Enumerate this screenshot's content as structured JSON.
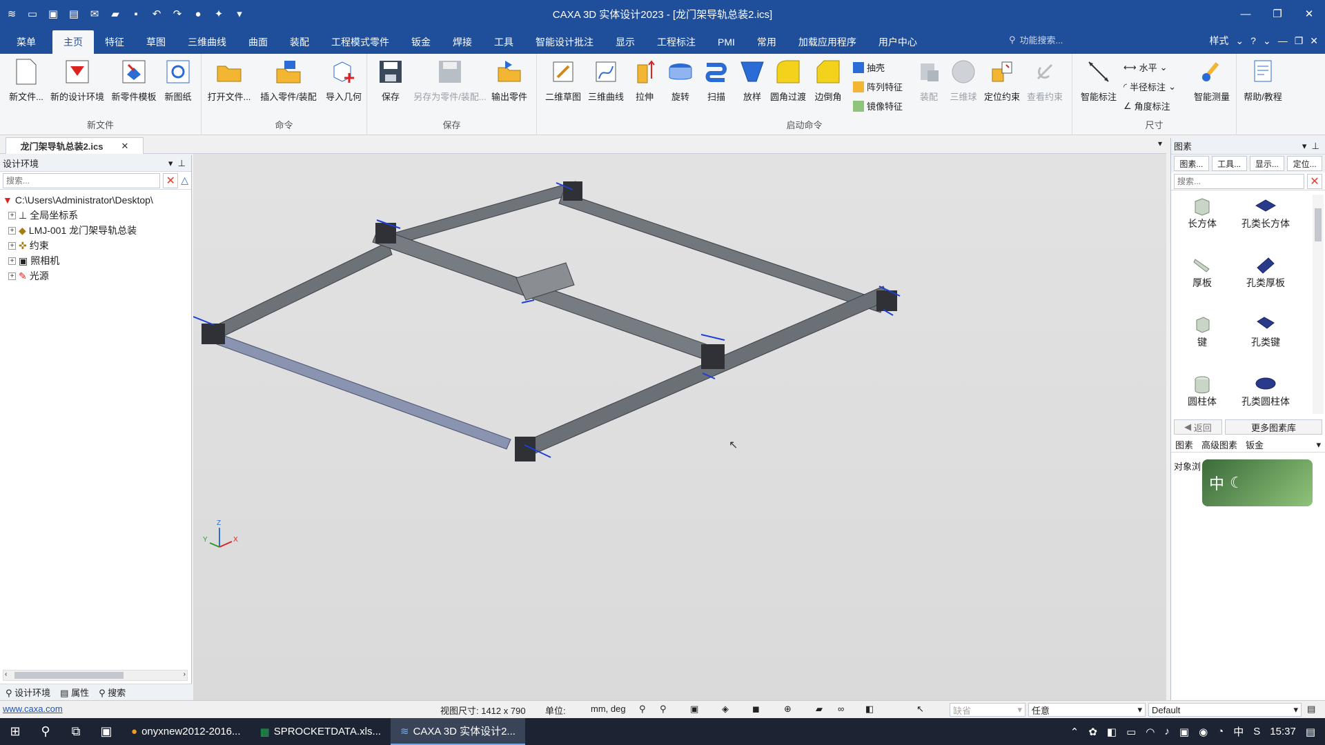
{
  "window": {
    "title": "CAXA 3D 实体设计2023 - [龙门架导轨总装2.ics]"
  },
  "ribbon_tabs": [
    "菜单",
    "主页",
    "特征",
    "草图",
    "三维曲线",
    "曲面",
    "装配",
    "工程模式零件",
    "钣金",
    "焊接",
    "工具",
    "智能设计批注",
    "显示",
    "工程标注",
    "PMI",
    "常用",
    "加载应用程序",
    "用户中心"
  ],
  "func_search_placeholder": "功能搜索...",
  "style_label": "样式",
  "groups": {
    "new_file": {
      "label": "新文件",
      "buttons": [
        "新文件...",
        "新的设计环境",
        "新零件模板",
        "新图纸"
      ]
    },
    "command": {
      "label": "命令",
      "buttons": [
        "打开文件...",
        "插入零件/装配",
        "导入几何"
      ]
    },
    "save": {
      "label": "保存",
      "buttons": [
        "保存",
        "另存为零件/装配...",
        "输出零件"
      ]
    },
    "launch": {
      "label": "启动命令",
      "buttons": [
        "二维草图",
        "三维曲线",
        "拉伸",
        "旋转",
        "扫描",
        "放样",
        "圆角过渡",
        "边倒角"
      ],
      "small": [
        "抽壳",
        "阵列特征",
        "镜像特征"
      ],
      "disabled": [
        "装配",
        "三维球",
        "定位约束",
        "查看约束"
      ]
    },
    "dimension": {
      "label": "尺寸",
      "buttons": [
        "智能标注"
      ],
      "small": [
        "水平",
        "半径标注",
        "角度标注"
      ],
      "measure": "智能测量"
    },
    "help": {
      "buttons": [
        "帮助/教程"
      ]
    }
  },
  "doc_tab": "龙门架导轨总装2.ics",
  "left_panel": {
    "title": "设计环境",
    "search_placeholder": "搜索...",
    "tree": [
      "C:\\Users\\Administrator\\Desktop\\",
      "全局坐标系",
      "LMJ-001 龙门架导轨总装",
      "约束",
      "照相机",
      "光源"
    ],
    "tabs": [
      "设计环境",
      "属性",
      "搜索"
    ]
  },
  "right_panel": {
    "title": "图素",
    "tools": [
      "图素...",
      "工具...",
      "显示...",
      "定位..."
    ],
    "search_placeholder": "搜索...",
    "items": [
      "长方体",
      "孔类长方体",
      "厚板",
      "孔类厚板",
      "键",
      "孔类键",
      "圆柱体",
      "孔类圆柱体"
    ],
    "back": "返回",
    "more": "更多图素库",
    "tabs": [
      "图素",
      "高级图素",
      "钣金"
    ],
    "object_label": "对象浏"
  },
  "ime_text": "中",
  "status": {
    "link": "www.caxa.com",
    "view_size": "视图尺寸: 1412 x 790",
    "unit_label": "单位:",
    "unit_value": "mm, deg",
    "filter_placeholder": "缺省",
    "mode": "任意",
    "scheme": "Default"
  },
  "axis_labels": {
    "x": "X",
    "y": "Y",
    "z": "Z"
  },
  "taskbar": {
    "apps": [
      "onyxnew2012-2016...",
      "SPROCKETDATA.xls...",
      "CAXA 3D 实体设计2..."
    ],
    "ime": "中",
    "time": "15:37"
  },
  "colors": {
    "titlebar": "#1f4e9a",
    "accent_red": "#e23b2f",
    "rail": "#6f737a",
    "shaft": "#8a93b0"
  }
}
